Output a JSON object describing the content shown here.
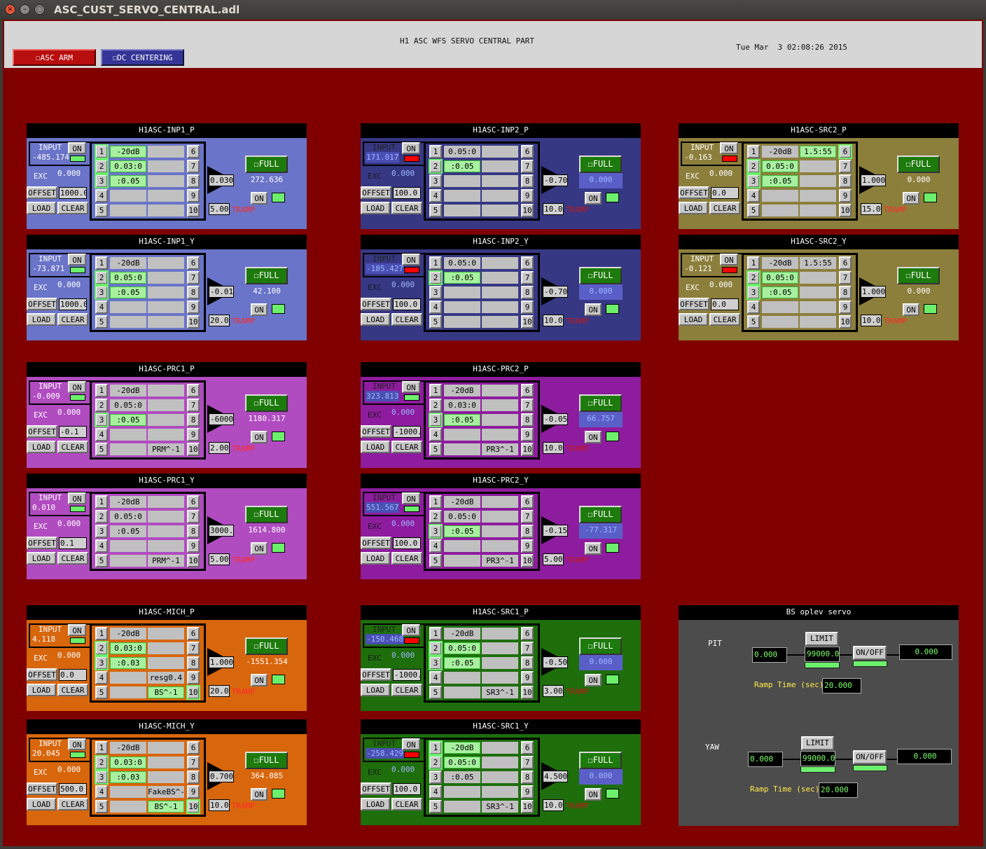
{
  "window": {
    "title": "ASC_CUST_SERVO_CENTRAL.adl"
  },
  "header": {
    "title": "H1 ASC WFS SERVO CENTRAL PART",
    "datetime": "Tue Mar  3 02:08:26 2015",
    "btn_arm": "ASC ARM",
    "btn_dc": "DC CENTERING",
    "btn_icon": "☐"
  },
  "labels": {
    "input": "INPUT",
    "on": "ON",
    "exc": "EXC",
    "offset": "OFFSET",
    "load": "LOAD",
    "clear": "CLEAR",
    "full": "FULL",
    "tramp": "TRAMP",
    "full_icon": "☐"
  },
  "panels": [
    {
      "name": "H1ASC-INP1_P",
      "color": "#6a74c8",
      "input": "-485.174",
      "exc": "0.000",
      "offset": "1000.0",
      "gain": "0.030",
      "output": "272.636",
      "tramp": "5.000",
      "input_ind": "#6cf06c",
      "fm": [
        [
          "-20dB",
          ""
        ],
        [
          "0.03:0",
          ""
        ],
        [
          ":0.05",
          ""
        ],
        [
          "",
          ""
        ],
        [
          "",
          ""
        ]
      ],
      "on": [
        1,
        2,
        3
      ],
      "dim": false
    },
    {
      "name": "H1ASC-INP2_P",
      "color": "#373884",
      "input": "171.017",
      "exc": "0.000",
      "offset": "100.0",
      "gain": "-0.700",
      "output": "0.000",
      "tramp": "10.000",
      "input_ind": "#ff0000",
      "fm": [
        [
          "0.05:0",
          ""
        ],
        [
          ":0.05",
          ""
        ],
        [
          "",
          ""
        ],
        [
          "",
          ""
        ],
        [
          "",
          ""
        ]
      ],
      "on": [
        2
      ],
      "dim": true
    },
    {
      "name": "H1ASC-SRC2_P",
      "color": "#8c7f3c",
      "input": "-0.163",
      "exc": "0.000",
      "offset": "0.0",
      "gain": "1.000",
      "output": "0.000",
      "tramp": "15.000",
      "input_ind": "#ff0000",
      "fm": [
        [
          "-20dB",
          "1.5:55"
        ],
        [
          "0.05:0",
          ""
        ],
        [
          ":0.05",
          ""
        ],
        [
          "",
          ""
        ],
        [
          "",
          ""
        ]
      ],
      "on": [
        2,
        3,
        6
      ],
      "dim": false
    },
    {
      "name": "H1ASC-INP1_Y",
      "color": "#6a74c8",
      "input": "-73.871",
      "exc": "0.000",
      "offset": "1000.0",
      "gain": "-0.010",
      "output": "42.100",
      "tramp": "20.000",
      "input_ind": "#6cf06c",
      "fm": [
        [
          "-20dB",
          ""
        ],
        [
          "0.05:0",
          ""
        ],
        [
          ":0.05",
          ""
        ],
        [
          "",
          ""
        ],
        [
          "",
          ""
        ]
      ],
      "on": [
        2,
        3
      ],
      "dim": false
    },
    {
      "name": "H1ASC-INP2_Y",
      "color": "#373884",
      "input": "-185.427",
      "exc": "0.000",
      "offset": "100.0",
      "gain": "-0.700",
      "output": "0.000",
      "tramp": "10.000",
      "input_ind": "#ff0000",
      "fm": [
        [
          "0.05:0",
          ""
        ],
        [
          ":0.05",
          ""
        ],
        [
          "",
          ""
        ],
        [
          "",
          ""
        ],
        [
          "",
          ""
        ]
      ],
      "on": [
        2
      ],
      "dim": true
    },
    {
      "name": "H1ASC-SRC2_Y",
      "color": "#8c7f3c",
      "input": "-0.121",
      "exc": "0.000",
      "offset": "0.0",
      "gain": "1.000",
      "output": "0.000",
      "tramp": "10.000",
      "input_ind": "#ff0000",
      "fm": [
        [
          "-20dB",
          "1.5:55"
        ],
        [
          "0.05:0",
          ""
        ],
        [
          ":0.05",
          ""
        ],
        [
          "",
          ""
        ],
        [
          "",
          ""
        ]
      ],
      "on": [
        2,
        3
      ],
      "dim": false
    },
    {
      "name": "H1ASC-PRC1_P",
      "color": "#b04cc0",
      "input": "-0.009",
      "exc": "0.000",
      "offset": "-0.1",
      "gain": "-6000.",
      "output": "1180.317",
      "tramp": "2.000",
      "input_ind": "#6cf06c",
      "fm": [
        [
          "-20dB",
          ""
        ],
        [
          "0.05:0",
          ""
        ],
        [
          ":0.05",
          ""
        ],
        [
          "",
          ""
        ],
        [
          "",
          "PRM^-1"
        ]
      ],
      "on": [
        3
      ],
      "dim": false
    },
    {
      "name": "H1ASC-PRC2_P",
      "color": "#8e1c9e",
      "input": "323.813",
      "exc": "0.000",
      "offset": "-1000.",
      "gain": "-0.050",
      "output": "66.757",
      "tramp": "10.000",
      "input_ind": "#6cf06c",
      "fm": [
        [
          "-20dB",
          ""
        ],
        [
          "0.03:0",
          ""
        ],
        [
          ":0.05",
          ""
        ],
        [
          "",
          ""
        ],
        [
          "",
          "PR3^-1"
        ]
      ],
      "on": [
        3
      ],
      "dim": true
    },
    {
      "name": "H1ASC-PRC1_Y",
      "color": "#b04cc0",
      "input": "0.010",
      "exc": "0.000",
      "offset": "0.1",
      "gain": "3000.0",
      "output": "1614.800",
      "tramp": "5.000",
      "input_ind": "#6cf06c",
      "fm": [
        [
          "-20dB",
          ""
        ],
        [
          "0.05:0",
          ""
        ],
        [
          ":0.05",
          ""
        ],
        [
          "",
          ""
        ],
        [
          "",
          "PRM^-1"
        ]
      ],
      "on": [],
      "dim": false
    },
    {
      "name": "H1ASC-PRC2_Y",
      "color": "#8e1c9e",
      "input": "551.567",
      "exc": "0.000",
      "offset": "100.0",
      "gain": "-0.150",
      "output": "-77.317",
      "tramp": "5.000",
      "input_ind": "#6cf06c",
      "fm": [
        [
          "-20dB",
          ""
        ],
        [
          "0.05:0",
          ""
        ],
        [
          ":0.05",
          ""
        ],
        [
          "",
          ""
        ],
        [
          "",
          "PR3^-1"
        ]
      ],
      "on": [
        3
      ],
      "dim": true
    },
    {
      "name": "H1ASC-MICH_P",
      "color": "#d8660c",
      "input": "4.118",
      "exc": "0.000",
      "offset": "0.0",
      "gain": "1.000",
      "output": "-1551.354",
      "tramp": "20.000",
      "input_ind": "#6cf06c",
      "fm": [
        [
          "-20dB",
          ""
        ],
        [
          "0.03:0",
          ""
        ],
        [
          ":0.03",
          ""
        ],
        [
          "",
          "resg0.4"
        ],
        [
          "",
          "BS^-1"
        ]
      ],
      "on": [
        2,
        3,
        10
      ],
      "dim": false
    },
    {
      "name": "H1ASC-SRC1_P",
      "color": "#1e6e0c",
      "input": "-150.468",
      "exc": "0.000",
      "offset": "-1000.",
      "gain": "-0.500",
      "output": "0.000",
      "tramp": "3.000",
      "input_ind": "#ff0000",
      "fm": [
        [
          "-20dB",
          ""
        ],
        [
          "0.05:0",
          ""
        ],
        [
          ":0.05",
          ""
        ],
        [
          "",
          ""
        ],
        [
          "",
          "SR3^-1"
        ]
      ],
      "on": [
        2,
        3
      ],
      "dim": true
    },
    {
      "name": "H1ASC-MICH_Y",
      "color": "#d8660c",
      "input": "20.045",
      "exc": "0.000",
      "offset": "500.0",
      "gain": "0.700",
      "output": "364.085",
      "tramp": "10.000",
      "input_ind": "#6cf06c",
      "fm": [
        [
          "-20dB",
          ""
        ],
        [
          "0.03:0",
          ""
        ],
        [
          ":0.03",
          ""
        ],
        [
          "",
          "FakeBS^-1"
        ],
        [
          "",
          "BS^-1"
        ]
      ],
      "on": [
        2,
        3,
        10
      ],
      "dim": false
    },
    {
      "name": "H1ASC-SRC1_Y",
      "color": "#1e6e0c",
      "input": "-258.429",
      "exc": "0.000",
      "offset": "100.0",
      "gain": "4.500",
      "output": "0.000",
      "tramp": "10.000",
      "input_ind": "#ff0000",
      "fm": [
        [
          "-20dB",
          ""
        ],
        [
          "0.05:0",
          ""
        ],
        [
          ":0.05",
          ""
        ],
        [
          "",
          ""
        ],
        [
          "",
          "SR3^-1"
        ]
      ],
      "on": [
        1,
        2
      ],
      "dim": true
    }
  ],
  "bs_oplev": {
    "title": "BS oplev servo",
    "pit": {
      "label": "PIT",
      "in": "0.000",
      "limit_label": "LIMIT",
      "limit_val": "99000.0",
      "onoff": "ON/OFF",
      "out": "0.000",
      "ramp_label": "Ramp Time (sec):",
      "ramp": "20.000"
    },
    "yaw": {
      "label": "YAW",
      "in": "0.000",
      "limit_label": "LIMIT",
      "limit_val": "99000.0",
      "onoff": "ON/OFF",
      "out": "0.000",
      "ramp_label": "Ramp Time (sec):",
      "ramp": "20.000"
    }
  }
}
